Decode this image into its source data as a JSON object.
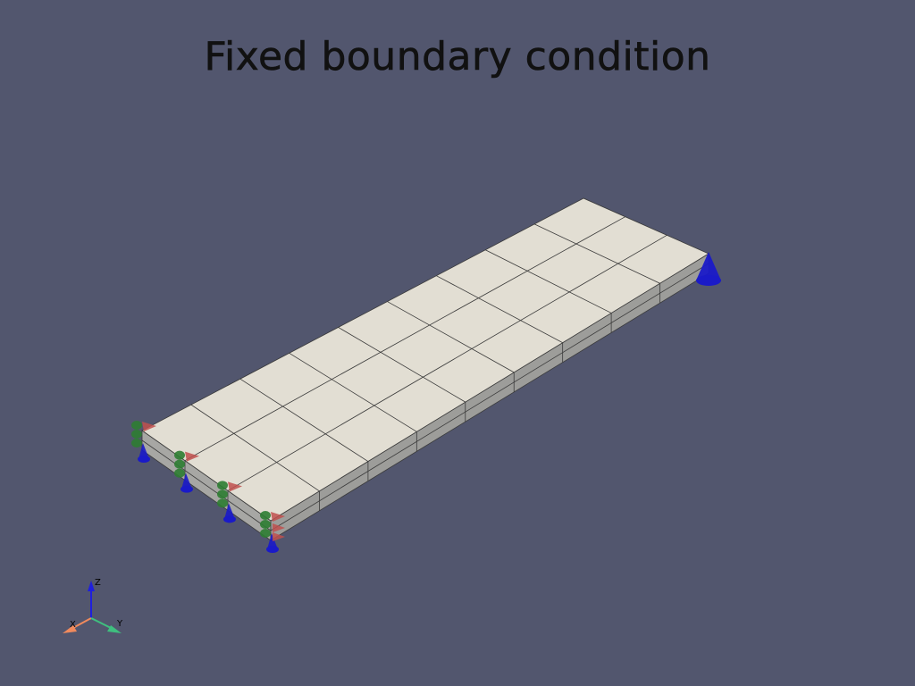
{
  "title": "Fixed boundary condition",
  "mesh": {
    "columns": 9,
    "rows": 3,
    "layers": 2,
    "surface_color": "#e2ded3",
    "side_color": "#a7a7a4",
    "edge_color": "#3a3a3a"
  },
  "boundary_markers": {
    "x_arrow_color": "#c0504d",
    "y_arrow_color": "#2e7d32",
    "z_arrow_color": "#1a1ac8"
  },
  "orientation_axes": {
    "x_label": "X",
    "y_label": "Y",
    "z_label": "Z",
    "x_color": "#f08a5d",
    "y_color": "#3fbf7f",
    "z_color": "#1f1fdd"
  }
}
